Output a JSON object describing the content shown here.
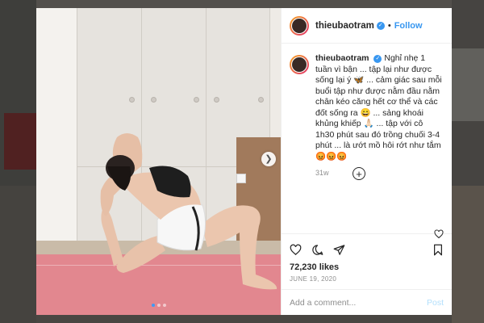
{
  "post": {
    "username": "thieubaotram",
    "verified_icon": "verified-badge-icon",
    "follow_separator": "•",
    "follow_label": "Follow",
    "caption": "Nghỉ nhẹ 1 tuần vì bận ... tập lại như được sống lại ý 🦋 ... cảm giác sau mỗi buổi tập như được nằm đầu nằm chân kéo căng hết cơ thể và các đốt sống ra 😄 ... sảng khoái khủng khiếp 🙏🏻 ... tập với cô 1h30 phút sau đó trồng chuối 3-4 phút ... là ướt mồ hôi rớt như tắm😡😡😡",
    "time_ago": "31w",
    "likes": "72,230 likes",
    "date": "JUNE 19, 2020",
    "comment_placeholder": "Add a comment...",
    "post_label": "Post",
    "carousel": {
      "total": 3,
      "active": 0
    }
  },
  "colors": {
    "accent": "#3897f0",
    "mat": "#e2878f"
  }
}
